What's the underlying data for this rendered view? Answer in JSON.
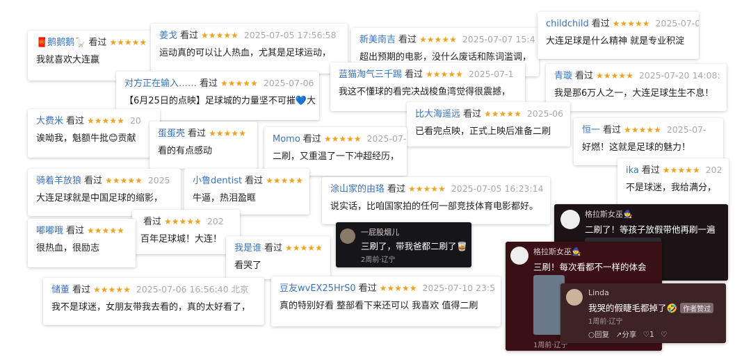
{
  "seen": "看过",
  "cards": [
    {
      "name": "🧧鹅鹅鹅🪿",
      "stars": "★★★★★",
      "text": "我就喜欢大连赢"
    },
    {
      "name": "姜戈",
      "stars": "★★★★★",
      "date": "2025-07-05 17:56:58",
      "text": "运动真的可以让人热血，尤其是足球运动，"
    },
    {
      "name": "对方正在输入……",
      "stars": "★★★★★",
      "date": "2025-07-06",
      "text": "【6月25日的点映】足球城的力量坚不可摧💙大"
    },
    {
      "name": "新美南吉",
      "stars": "★★★★★",
      "date": "2025-07-07 15:4",
      "text": "超出预期的电影，没什么废话和陈词滥调，"
    },
    {
      "name": "蓝猫淘气三千踢",
      "stars": "★★★★★",
      "date": "2025-07-1",
      "text": "我这不懂球的看完决战梭鱼湾觉得很震撼，"
    },
    {
      "name": "childchild",
      "stars": "★★★★★",
      "date": "2025-07-0",
      "text": "大连足球是什么精神 就是专业积淀"
    },
    {
      "name": "青璇",
      "stars": "★★★★★",
      "date": "2025-07-20 14:08:",
      "text": "我是那6万人之一，大连足球生生不息！"
    },
    {
      "name": "大费米",
      "stars": "★★★★★",
      "date": "20",
      "text": "诶呦我，魁额牛批😊贡献"
    },
    {
      "name": "蛋蛋壳",
      "stars": "★★★★★",
      "text": "看的有点感动"
    },
    {
      "name": "Momo",
      "stars": "★★★★★",
      "date": "2025-07-",
      "text": "二刷，又重温了一下冲超经历，"
    },
    {
      "name": "比大海遥远",
      "stars": "★★★★★",
      "date": "2025-06",
      "text": "已看完点映，正式上映后准备二刷"
    },
    {
      "name": "恒一",
      "stars": "★★★★★",
      "date": "2025-07-",
      "text": "好燃！这就是足球的魅力！"
    },
    {
      "name": "骑着羊放狼",
      "stars": "★★★★★",
      "date": "2025",
      "text": "大连足球就是中国足球的缩影，"
    },
    {
      "name": "小鲁dentist",
      "stars": "★★★★★",
      "text": "牛逼，热泪盈眶"
    },
    {
      "name": "涂山家的由珞",
      "stars": "★★★★★",
      "date": "2025-07-05 16:23:14",
      "text": "说实话，比咱国家拍的任何一部竞技体育电影都好。"
    },
    {
      "name": "ika",
      "stars": "★★★★★",
      "date": "202",
      "text": "不是球迷，我给满分，"
    },
    {
      "name": "嘟嘟哦",
      "stars": "★★★★★",
      "text": "很热血，很励志"
    },
    {
      "name": "",
      "stars": "★★★★★",
      "date": "202",
      "text": "百年足球城！大连！"
    },
    {
      "name": "我是谁",
      "stars": "★★★★★",
      "text": "看哭了"
    },
    {
      "name": "储董",
      "stars": "★★★★★",
      "date": "2025-07-06 16:56:40 北京",
      "text": "我不是球迷，女朋友带我去看的，真的太好看了，"
    },
    {
      "name": "豆友wvEX25HrS0",
      "stars": "★★★★★",
      "date": "2025-07-10 23:5",
      "text": "真的特别好看 整部看下来还可以 我喜欢 值得二刷"
    }
  ],
  "dark_comments": {
    "c1": {
      "name": "一屁股烟儿",
      "text": "三刷了，带我爸都二刷了🥃",
      "meta": "2周前·辽宁"
    },
    "c2": {
      "name": "格拉斯女巫🧙",
      "text": "二刷了！等孩子放假带他再刷一遍"
    },
    "c3": {
      "name": "格拉斯女巫🧙",
      "text": "三刷！每次看都不一样的体会",
      "meta": "1周前·辽宁"
    },
    "c4": {
      "name": "Linda",
      "text": "我哭的假睫毛都掉了🤣",
      "badge": "作者赞过",
      "meta": "1周前·辽宁",
      "actions": {
        "reply": "回复",
        "share": "分享",
        "likes": "1"
      }
    }
  }
}
